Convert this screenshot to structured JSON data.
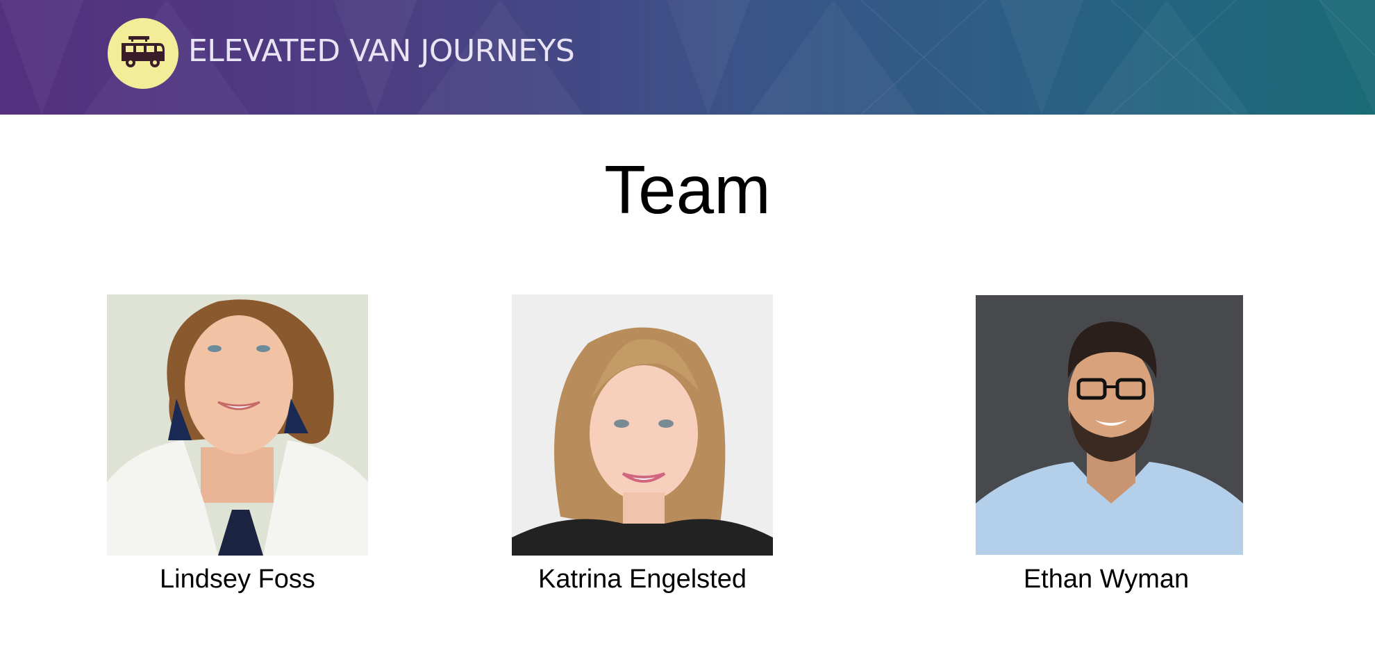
{
  "brand": {
    "name": "ELEVATED VAN JOURNEYS",
    "logo_icon": "van-icon",
    "colors": {
      "logo_bg": "#f3ec98",
      "header_start": "#55307e",
      "header_end": "#1a6b76"
    }
  },
  "page": {
    "title": "Team"
  },
  "team": [
    {
      "name": "Lindsey Foss",
      "photo": "woman-curly-hair-portrait"
    },
    {
      "name": "Katrina Engelsted",
      "photo": "woman-blonde-hair-portrait"
    },
    {
      "name": "Ethan Wyman",
      "photo": "man-glasses-beard-portrait"
    }
  ]
}
